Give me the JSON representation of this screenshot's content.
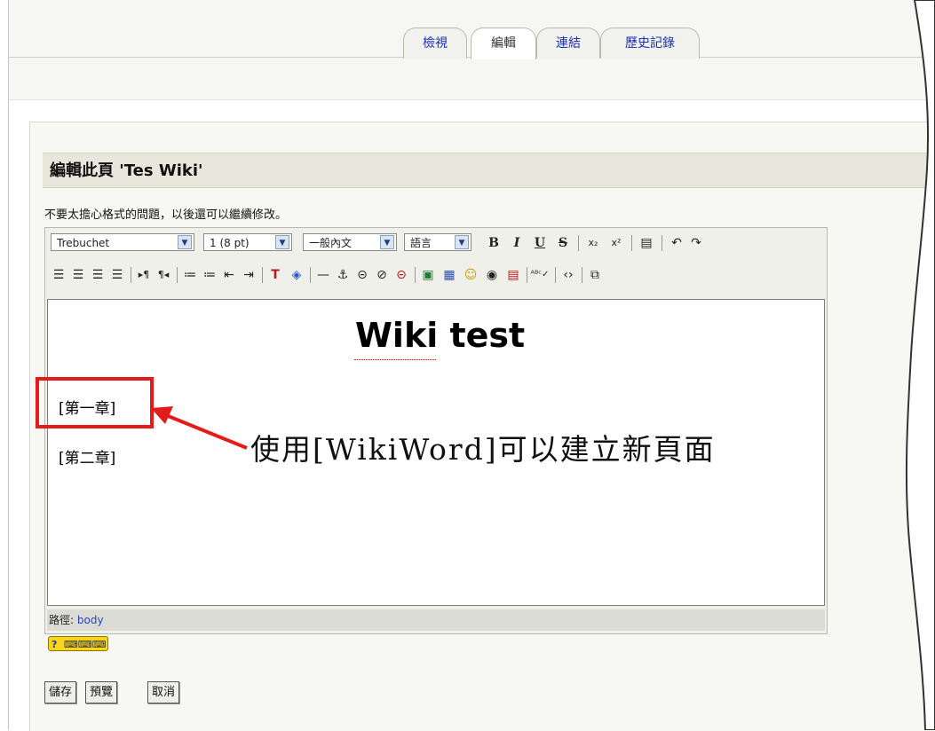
{
  "tabs": [
    {
      "label": "檢視",
      "active": false
    },
    {
      "label": "編輯",
      "active": true
    },
    {
      "label": "連結",
      "active": false
    },
    {
      "label": "歷史記錄",
      "active": false
    }
  ],
  "page_heading": "編輯此頁 'Tes Wiki'",
  "hint_text": "不要太擔心格式的問題，以後還可以繼續修改。",
  "toolbar": {
    "font_family": "Trebuchet",
    "font_size": "1 (8 pt)",
    "format": "一般內文",
    "language": "語言"
  },
  "editor": {
    "title": "Wiki test",
    "chapter1": "[第一章]",
    "chapter2": "[第二章]"
  },
  "status": {
    "label": "路徑:",
    "path": "body"
  },
  "keyboard_help": "?",
  "buttons": {
    "save": "儲存",
    "preview": "預覽",
    "cancel": "取消"
  },
  "annotation": "使用[WikiWord]可以建立新頁面",
  "colors": {
    "link": "#1c2fb8",
    "highlight_red": "#e51b1b",
    "heading_bg": "#e9e6dc"
  }
}
